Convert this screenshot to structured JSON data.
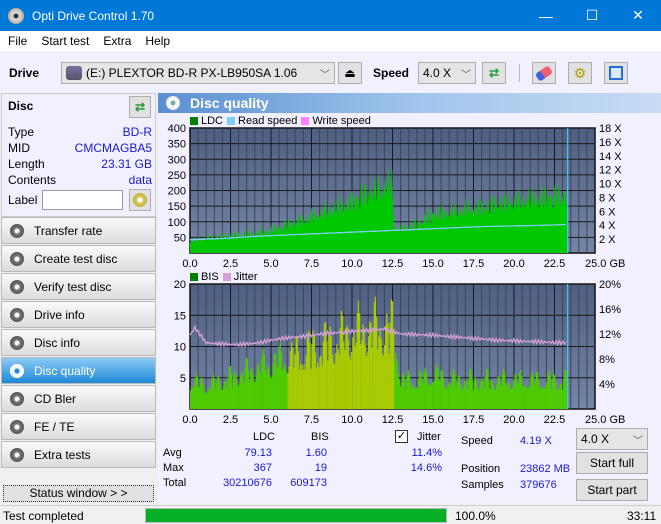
{
  "window": {
    "title": "Opti Drive Control 1.70",
    "minimize": "—",
    "maximize": "☐",
    "close": "✕"
  },
  "menu": [
    "File",
    "Start test",
    "Extra",
    "Help"
  ],
  "toolbar": {
    "drive_label": "Drive",
    "drive_value": "(E:)  PLEXTOR BD-R  PX-LB950SA 1.06",
    "speed_label": "Speed",
    "speed_value": "4.0 X",
    "icons": [
      "eject-icon",
      "refresh-icon",
      "erase-icon",
      "settings-icon",
      "save-icon"
    ]
  },
  "disc": {
    "header": "Disc",
    "rows": [
      {
        "k": "Type",
        "v": "BD-R"
      },
      {
        "k": "MID",
        "v": "CMCMAGBA5"
      },
      {
        "k": "Length",
        "v": "23.31 GB"
      },
      {
        "k": "Contents",
        "v": "data"
      }
    ],
    "label_key": "Label",
    "label_value": ""
  },
  "nav": [
    {
      "label": "Transfer rate"
    },
    {
      "label": "Create test disc"
    },
    {
      "label": "Verify test disc"
    },
    {
      "label": "Drive info"
    },
    {
      "label": "Disc info"
    },
    {
      "label": "Disc quality",
      "active": true
    },
    {
      "label": "CD Bler"
    },
    {
      "label": "FE / TE"
    },
    {
      "label": "Extra tests"
    }
  ],
  "status_window_btn": "Status window > >",
  "panel": {
    "title": "Disc quality"
  },
  "chart_data": [
    {
      "type": "area",
      "title": "LDC",
      "legend": [
        "LDC",
        "Read speed",
        "Write speed"
      ],
      "legend_colors": [
        "#008000",
        "#7ecff5",
        "#ff80ff"
      ],
      "xlabel": "GB",
      "x_ticks": [
        "0.0",
        "2.5",
        "5.0",
        "7.5",
        "10.0",
        "12.5",
        "15.0",
        "17.5",
        "20.0",
        "22.5",
        "25.0 GB"
      ],
      "xlim": [
        0,
        25
      ],
      "y_ticks": [
        "50",
        "100",
        "150",
        "200",
        "250",
        "300",
        "350",
        "400"
      ],
      "ylim": [
        0,
        400
      ],
      "y2_ticks": [
        "2 X",
        "4 X",
        "6 X",
        "8 X",
        "10 X",
        "12 X",
        "14 X",
        "16 X",
        "18 X"
      ],
      "y2lim": [
        0,
        18
      ],
      "series": [
        {
          "name": "LDC",
          "x": [
            0,
            1,
            2,
            3,
            4,
            5,
            6,
            7,
            8,
            9,
            10,
            10.5,
            11,
            11.5,
            12,
            12.5,
            12.6,
            13,
            14,
            15,
            16,
            17,
            18,
            19,
            20,
            21,
            22,
            23,
            23.3
          ],
          "values": [
            40,
            50,
            55,
            60,
            65,
            75,
            95,
            110,
            130,
            150,
            170,
            190,
            200,
            210,
            220,
            230,
            85,
            80,
            95,
            130,
            135,
            145,
            150,
            165,
            170,
            180,
            185,
            190,
            190
          ]
        },
        {
          "name": "Read speed",
          "x": [
            0,
            2,
            4,
            6,
            8,
            10,
            12,
            14,
            16,
            18,
            20,
            22,
            23.3
          ],
          "values": [
            1.9,
            2.1,
            2.4,
            2.6,
            2.8,
            3.0,
            3.2,
            3.4,
            3.6,
            3.8,
            3.9,
            4.0,
            4.1
          ]
        }
      ],
      "marker_x": 23.31
    },
    {
      "type": "bar",
      "title": "BIS",
      "legend": [
        "BIS",
        "Jitter"
      ],
      "legend_colors": [
        "#008000",
        "#d8a0d8"
      ],
      "x_ticks": [
        "0.0",
        "2.5",
        "5.0",
        "7.5",
        "10.0",
        "12.5",
        "15.0",
        "17.5",
        "20.0",
        "22.5",
        "25.0 GB"
      ],
      "xlim": [
        0,
        25
      ],
      "y_ticks": [
        "5",
        "10",
        "15",
        "20"
      ],
      "ylim": [
        0,
        20
      ],
      "y2_ticks": [
        "4%",
        "8%",
        "12%",
        "16%",
        "20%"
      ],
      "y2lim": [
        0,
        20
      ],
      "series": [
        {
          "name": "BIS",
          "x": [
            0,
            1,
            2,
            3,
            4,
            5,
            6,
            7,
            8,
            9,
            10,
            11,
            12,
            12.5,
            13,
            14,
            15,
            16,
            17,
            18,
            19,
            20,
            21,
            22,
            23,
            23.3
          ],
          "values": [
            5,
            4,
            5,
            6,
            7,
            8,
            9,
            10,
            11,
            12,
            13,
            14,
            14,
            14,
            5,
            5,
            6,
            5,
            5,
            5,
            5,
            5,
            5,
            5,
            5,
            5
          ]
        },
        {
          "name": "Jitter",
          "x": [
            0,
            0.3,
            1,
            2,
            3,
            4,
            5,
            6,
            7,
            8,
            9,
            10,
            11,
            12,
            13,
            14,
            15,
            16,
            17,
            18,
            19,
            20,
            21,
            22,
            23,
            23.3
          ],
          "values": [
            11.8,
            13.0,
            10.6,
            10.4,
            10.3,
            10.5,
            11.0,
            11.4,
            11.6,
            12.0,
            12.2,
            12.4,
            12.6,
            12.8,
            12.0,
            11.9,
            11.8,
            11.6,
            11.4,
            11.2,
            11.0,
            10.9,
            10.8,
            10.7,
            10.6,
            10.6
          ]
        }
      ],
      "marker_x": 23.31
    }
  ],
  "stats": {
    "col_ldc": "LDC",
    "col_bis": "BIS",
    "jitter_label": "Jitter",
    "jitter_checked": true,
    "rows": [
      {
        "k": "Avg",
        "ldc": "79.13",
        "bis": "1.60",
        "jitter": "11.4%"
      },
      {
        "k": "Max",
        "ldc": "367",
        "bis": "19",
        "jitter": "14.6%"
      },
      {
        "k": "Total",
        "ldc": "30210676",
        "bis": "609173",
        "jitter": ""
      }
    ],
    "speed_label": "Speed",
    "speed_value": "4.19 X",
    "position_label": "Position",
    "position_value": "23862 MB",
    "samples_label": "Samples",
    "samples_value": "379676",
    "speed_select": "4.0 X",
    "start_full": "Start full",
    "start_part": "Start part"
  },
  "statusbar": {
    "text": "Test completed",
    "progress": 1.0,
    "progress_text": "100.0%",
    "time": "33:11"
  }
}
